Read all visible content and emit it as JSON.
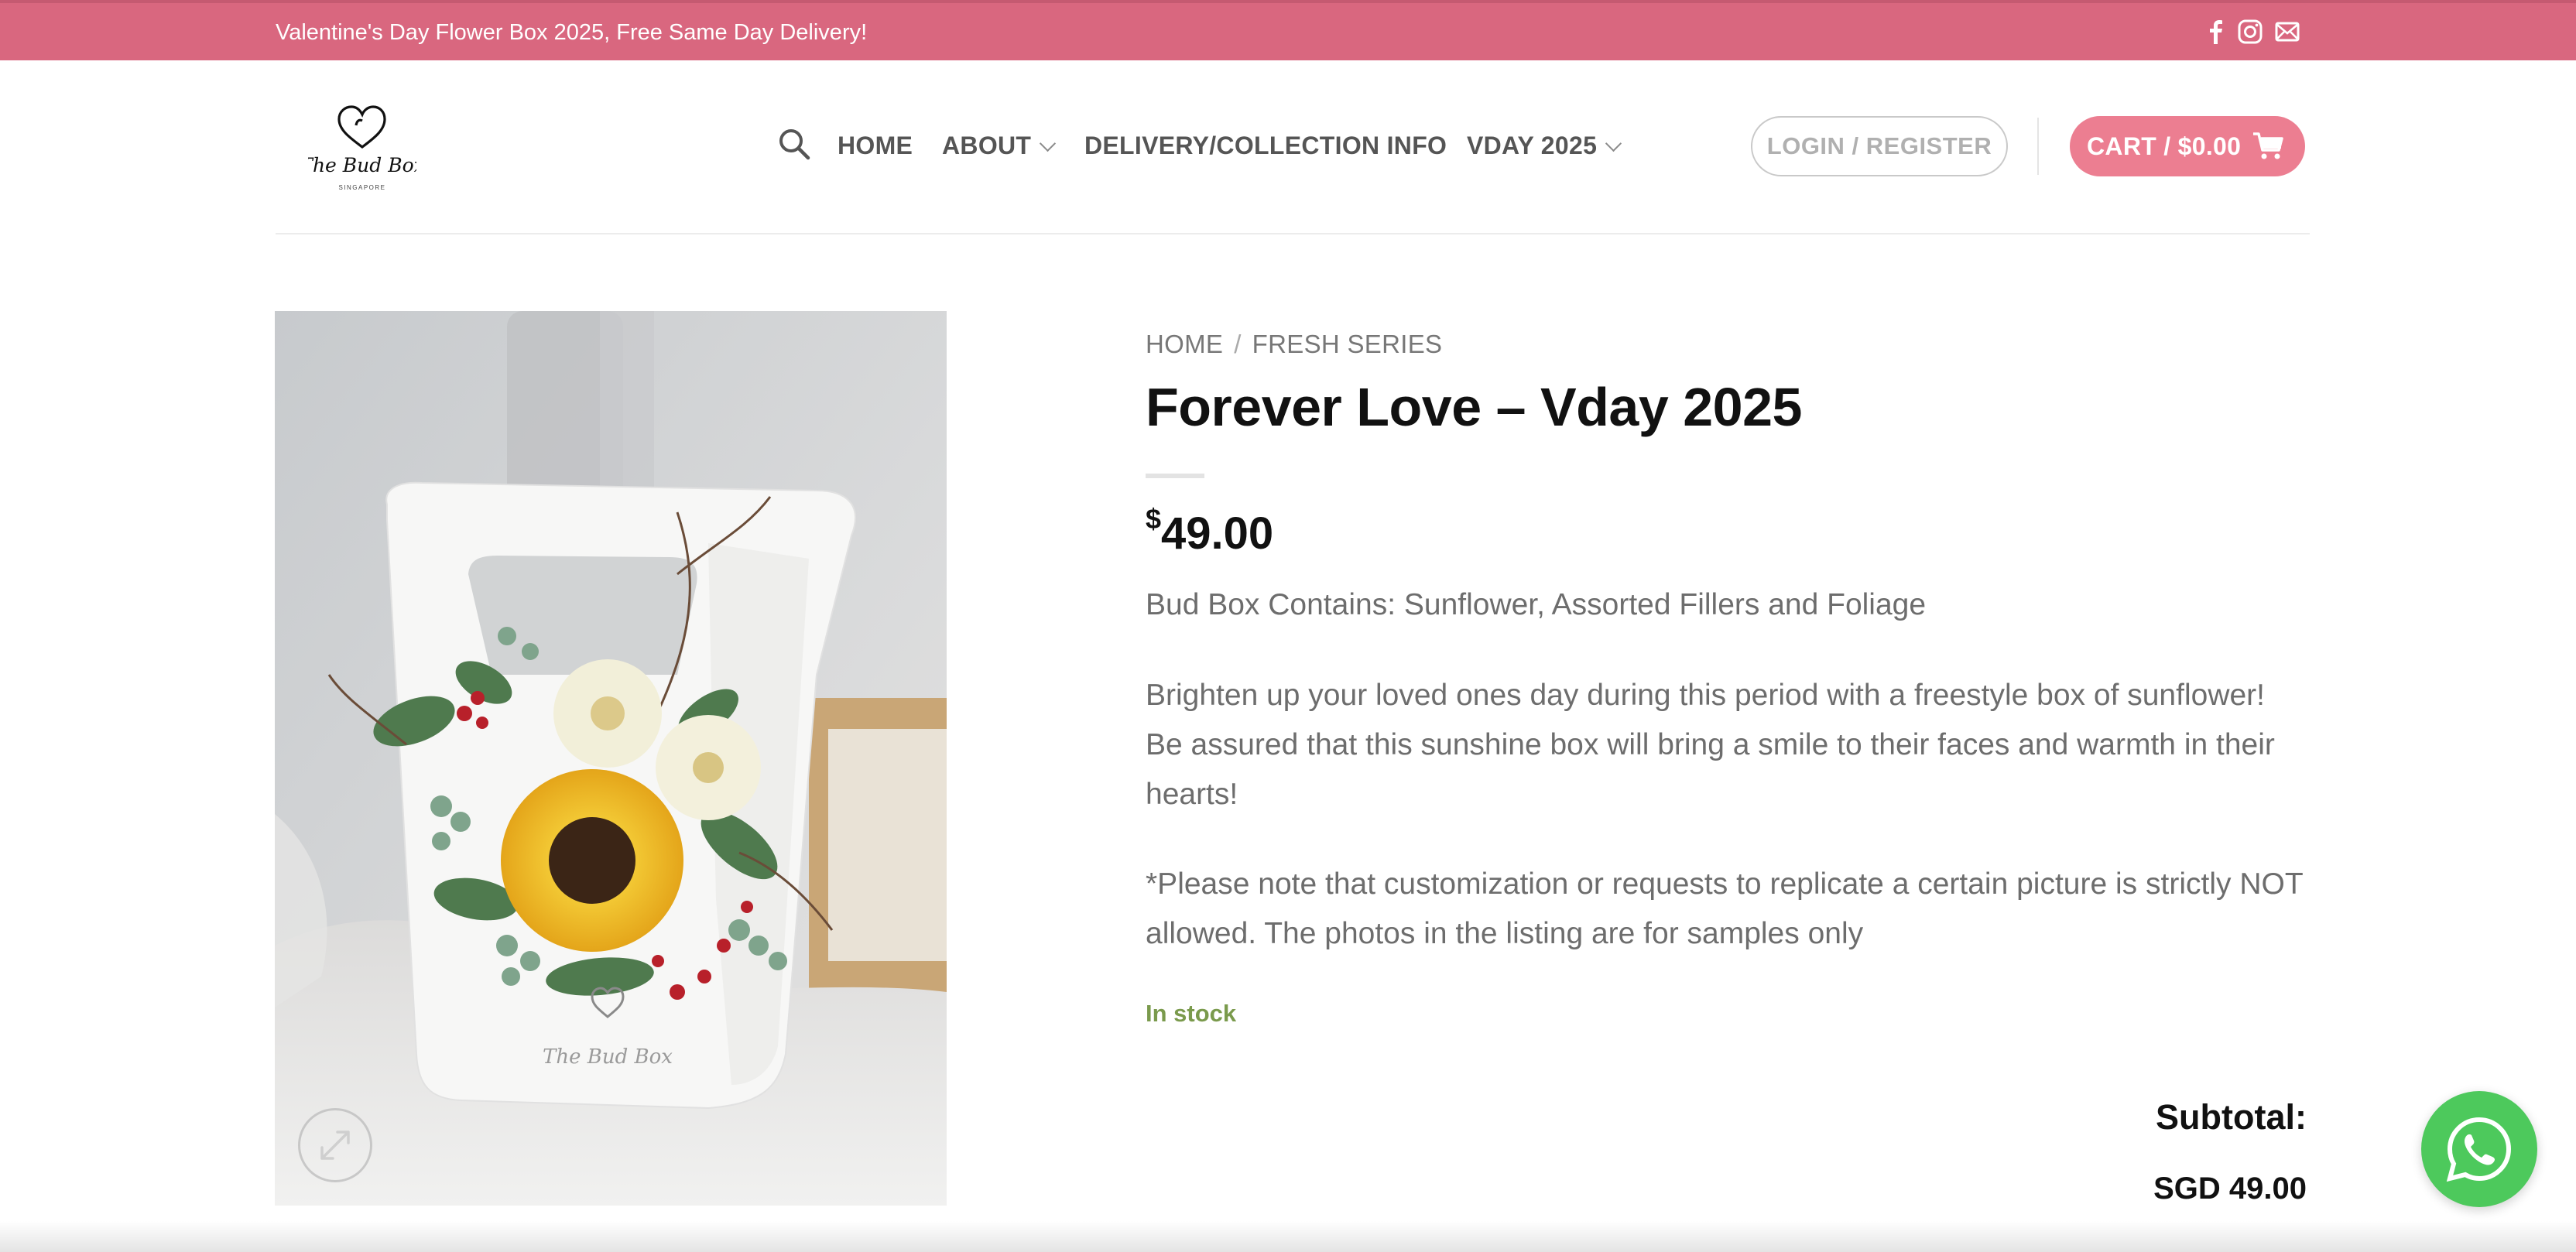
{
  "topbar": {
    "announcement": "Valentine's Day Flower Box 2025, Free Same Day Delivery!",
    "social_icons": [
      "facebook-icon",
      "instagram-icon",
      "email-icon"
    ],
    "background_color": "#d9677f"
  },
  "header": {
    "logo": {
      "text": "The Bud Box",
      "subtext": "SINGAPORE"
    },
    "nav": {
      "home": "HOME",
      "about": "ABOUT",
      "delivery": "DELIVERY/COLLECTION INFO",
      "vday": "VDAY 2025"
    },
    "login_label": "LOGIN / REGISTER",
    "cart_label": "CART / $0.00",
    "cart_color": "#ec7e91"
  },
  "product": {
    "breadcrumb": {
      "home": "HOME",
      "separator": "/",
      "category": "FRESH SERIES"
    },
    "title": "Forever Love – Vday 2025",
    "currency_symbol": "$",
    "price": "49.00",
    "contents": "Bud Box Contains: Sunflower, Assorted Fillers and Foliage",
    "description": "Brighten up your loved ones day during this period with a freestyle box of sunflower! Be assured that this sunshine box will bring a smile to their faces and warmth in their hearts!",
    "note": "*Please note that customization or requests to replicate a certain picture is strictly NOT allowed. The photos in the listing are for samples only",
    "stock_status": "In stock",
    "stock_color": "#7a9a4c",
    "subtotal_label": "Subtotal:",
    "subtotal_value": "SGD 49.00",
    "image": {
      "box_text": "The Bud Box"
    }
  },
  "widgets": {
    "chat_icon": "whatsapp-icon",
    "chat_color": "#4dc95c"
  }
}
